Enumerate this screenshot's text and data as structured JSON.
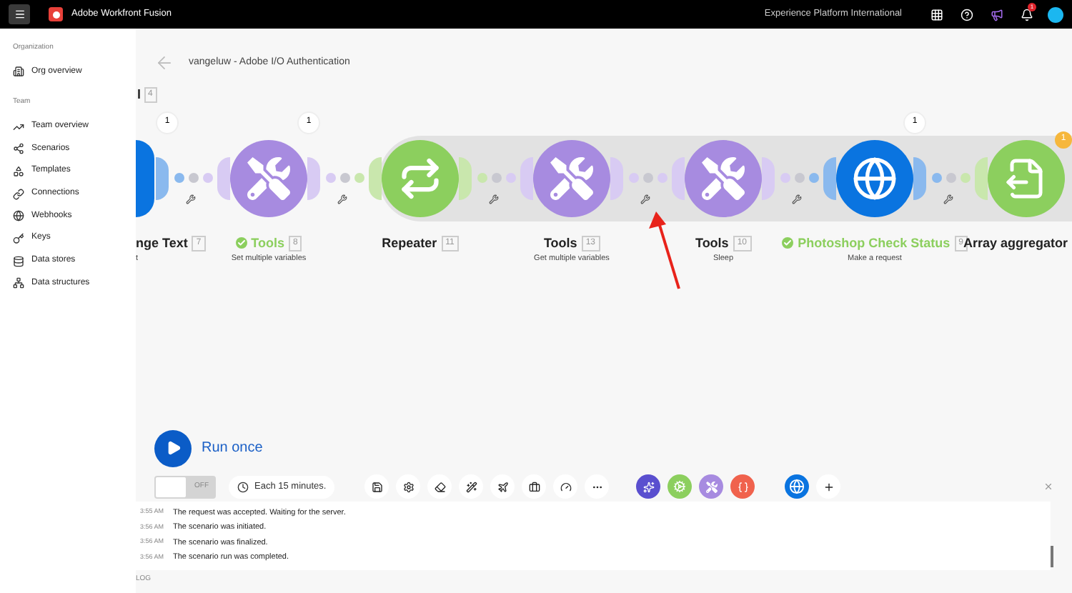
{
  "top_bar": {
    "app_title": "Adobe Workfront Fusion",
    "organization": "Experience Platform International",
    "notification_count": "1"
  },
  "sidebar": {
    "sections": [
      {
        "heading": "Organization",
        "items": [
          {
            "label": "Org overview"
          }
        ]
      },
      {
        "heading": "Team",
        "items": [
          {
            "label": "Team overview"
          },
          {
            "label": "Scenarios"
          },
          {
            "label": "Templates"
          },
          {
            "label": "Connections"
          },
          {
            "label": "Webhooks"
          },
          {
            "label": "Keys"
          },
          {
            "label": "Data stores"
          },
          {
            "label": "Data structures"
          }
        ]
      }
    ]
  },
  "scenario": {
    "title": "vangeluw - Adobe I/O Authentication"
  },
  "partial_module": {
    "label": "l",
    "number": "4"
  },
  "modules": [
    {
      "kind": "text",
      "label": "nge Text",
      "number": "7",
      "subtitle": "t",
      "success": false,
      "bubble": "1"
    },
    {
      "kind": "tools",
      "label": "Tools",
      "number": "8",
      "subtitle": "Set multiple variables",
      "success": true,
      "bubble": "1"
    },
    {
      "kind": "repeater",
      "label": "Repeater",
      "number": "11",
      "success": false
    },
    {
      "kind": "tools",
      "label": "Tools",
      "number": "13",
      "subtitle": "Get multiple variables",
      "success": false
    },
    {
      "kind": "tools",
      "label": "Tools",
      "number": "10",
      "subtitle": "Sleep",
      "success": false
    },
    {
      "kind": "http",
      "label": "Photoshop Check Status",
      "number": "9",
      "subtitle": "Make a request",
      "success": true,
      "bubble": "1"
    },
    {
      "kind": "aggregator",
      "label": "Array aggregator",
      "success": false,
      "badge": "1"
    }
  ],
  "run": {
    "label": "Run once"
  },
  "scheduling": {
    "on": false,
    "label": "OFF",
    "interval": "Each 15 minutes."
  },
  "log": {
    "label": "LOG",
    "entries": [
      {
        "time": "3:55 AM",
        "message": "The request was accepted. Waiting for the server."
      },
      {
        "time": "3:56 AM",
        "message": "The scenario was initiated."
      },
      {
        "time": "3:56 AM",
        "message": "The scenario was finalized."
      },
      {
        "time": "3:56 AM",
        "message": "The scenario run was completed."
      }
    ]
  }
}
